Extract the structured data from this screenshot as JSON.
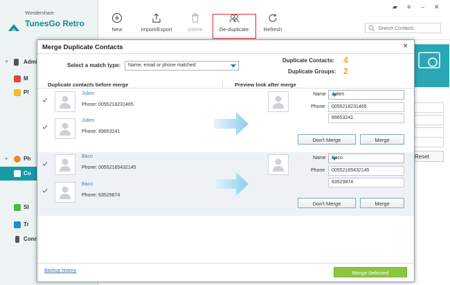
{
  "app": {
    "brand_small": "Wondershare",
    "brand_name": "TunesGo Retro",
    "sidebar_items": [
      {
        "label": "Admi",
        "icon": "phone-icon"
      },
      {
        "label": "M",
        "icon": "music-icon"
      },
      {
        "label": "Pl",
        "icon": "playlist-icon"
      },
      {
        "label": "Ph",
        "icon": "photos-icon"
      },
      {
        "label": "Co",
        "icon": "contacts-icon"
      },
      {
        "label": "SI",
        "icon": "sms-icon"
      },
      {
        "label": "Tr",
        "icon": "toolbox-icon"
      },
      {
        "label": "Conn",
        "icon": "connect-icon"
      }
    ],
    "toolbar": {
      "new": "New",
      "import_export": "Import/Export",
      "delete": "Delete",
      "deduplicate": "De-duplicate",
      "refresh": "Refresh"
    },
    "search_placeholder": "Search Contacts",
    "reset_label": "Reset"
  },
  "modal": {
    "title": "Merge Duplicate Contacts",
    "match_label": "Select a match type:",
    "match_value": "Name, email or phone matched",
    "duplicate_contacts_label": "Duplicate Contacts:",
    "duplicate_contacts_value": "4",
    "duplicate_groups_label": "Duplicate Groups:",
    "duplicate_groups_value": "2",
    "col_before": "Duplicate contacts before merge",
    "col_after": "Preview look after merge",
    "groups": [
      {
        "contacts": [
          {
            "name": "Julien",
            "phone": "Phone: 0055218231465"
          },
          {
            "name": "Julien",
            "phone": "Phone: 89653241"
          }
        ],
        "preview": {
          "name_label": "Name",
          "name_value": "Julien",
          "phone_label": "Phone",
          "phones": [
            "0055218231465",
            "89653241"
          ]
        },
        "dont_merge": "Don't Merge",
        "merge": "Merge"
      },
      {
        "contacts": [
          {
            "name": "Baco",
            "phone": "Phone: 00552165432145"
          },
          {
            "name": "Baco",
            "phone": "Phone: 63529874"
          }
        ],
        "preview": {
          "name_label": "Name",
          "name_value": "Baco",
          "phone_label": "Phone",
          "phones": [
            "00552165432145",
            "63529874"
          ]
        },
        "dont_merge": "Don't Merge",
        "merge": "Merge"
      }
    ],
    "backup_history": "Backup history",
    "merge_selected": "Merge Selected"
  },
  "colors": {
    "accent_teal": "#159aa8",
    "stat_orange": "#f0a21a",
    "link_blue": "#3a7cc7",
    "merge_green": "#8cc63f",
    "highlight_red": "#e02b2b"
  }
}
